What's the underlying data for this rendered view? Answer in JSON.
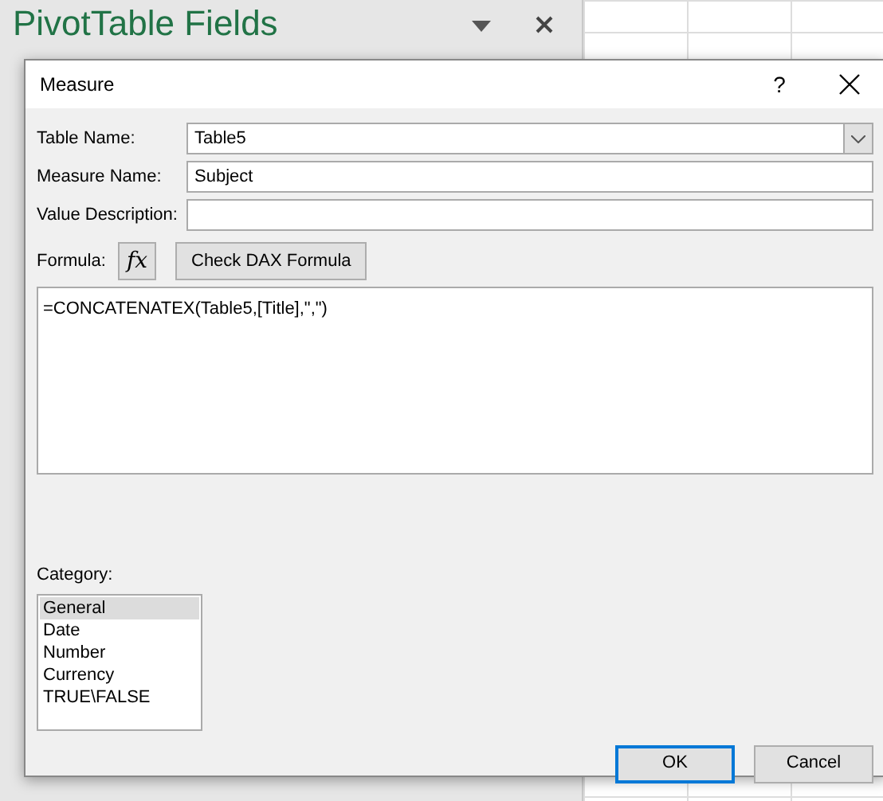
{
  "background_pane": {
    "title": "PivotTable Fields"
  },
  "dialog": {
    "title": "Measure",
    "help": "?",
    "fields": [
      {
        "kind": "select",
        "label": "Table Name:",
        "value": "Table5"
      },
      {
        "kind": "text",
        "label": "Measure Name:",
        "value": "Subject"
      },
      {
        "kind": "text",
        "label": "Value Description:"
      }
    ],
    "formula": {
      "label": "Formula:",
      "fx": "fx",
      "check_button": "Check DAX Formula",
      "value": "=CONCATENATEX(Table5,[Title],\",\")"
    },
    "category": {
      "label": "Category:",
      "items": [
        {
          "label": "General",
          "selected": true
        },
        {
          "label": "Date",
          "selected": false
        },
        {
          "label": "Number",
          "selected": false
        },
        {
          "label": "Currency",
          "selected": false
        },
        {
          "label": "TRUE\\FALSE",
          "selected": false
        }
      ]
    },
    "buttons": [
      {
        "label": "OK",
        "default": true
      },
      {
        "label": "Cancel",
        "default": false
      }
    ]
  }
}
